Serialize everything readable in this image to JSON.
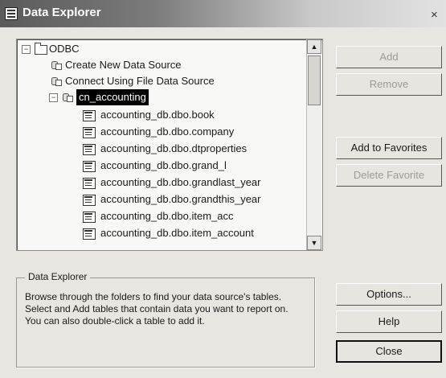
{
  "window": {
    "title": "Data Explorer",
    "close_glyph": "×"
  },
  "tree": {
    "root": {
      "label": "ODBC",
      "expander": "−"
    },
    "items": [
      {
        "label": "Create New Data Source"
      },
      {
        "label": "Connect Using File Data Source"
      }
    ],
    "selected_node": {
      "label": "cn_accounting",
      "expander": "−"
    },
    "tables": [
      "accounting_db.dbo.book",
      "accounting_db.dbo.company",
      "accounting_db.dbo.dtproperties",
      "accounting_db.dbo.grand_l",
      "accounting_db.dbo.grandlast_year",
      "accounting_db.dbo.grandthis_year",
      "accounting_db.dbo.item_acc",
      "accounting_db.dbo.item_account"
    ],
    "scroll_up": "▲",
    "scroll_down": "▼"
  },
  "buttons": {
    "add": "Add",
    "remove": "Remove",
    "add_favorites": "Add to Favorites",
    "delete_favorite": "Delete Favorite",
    "options": "Options...",
    "help": "Help",
    "close": "Close"
  },
  "info": {
    "title": "Data Explorer",
    "text": "Browse through the folders to find your data source's tables.  Select and Add tables that contain data you want to report on.  You can also double-click a table to add it."
  }
}
